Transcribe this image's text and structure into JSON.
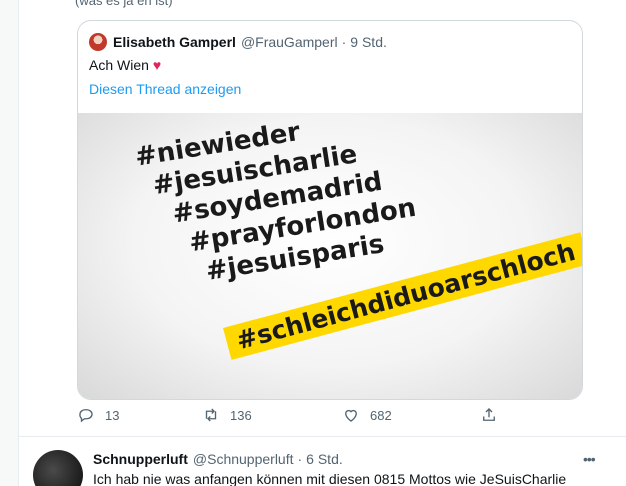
{
  "prev_tweet": {
    "text_fragment": "(was es ja eh ist)"
  },
  "quote": {
    "name": "Elisabeth Gamperl",
    "handle": "@FrauGamperl",
    "separator": "·",
    "time": "9 Std.",
    "text": "Ach Wien",
    "heart": "♥",
    "thread_link": "Diesen Thread anzeigen",
    "image": {
      "hashtags": [
        "#niewieder",
        "#jesuischarlie",
        "#soydemadrid",
        "#prayforlondon",
        "#jesuisparis"
      ],
      "highlight": "#schleichdiduoarschloch",
      "highlight_color": "#ffd800"
    }
  },
  "actions": {
    "replies": "13",
    "retweets": "136",
    "likes": "682"
  },
  "tweet2": {
    "name": "Schnupperluft",
    "handle": "@Schnupperluft",
    "separator": "·",
    "time": "6 Std.",
    "more": "•••",
    "text": "Ich hab nie was anfangen können mit diesen 0815 Mottos wie JeSuisCharlie"
  },
  "colors": {
    "link": "#1d9bf0",
    "muted": "#536471",
    "border": "#cfd9de",
    "heart": "#e0245e"
  },
  "icons": [
    "reply-icon",
    "retweet-icon",
    "like-icon",
    "share-icon"
  ]
}
